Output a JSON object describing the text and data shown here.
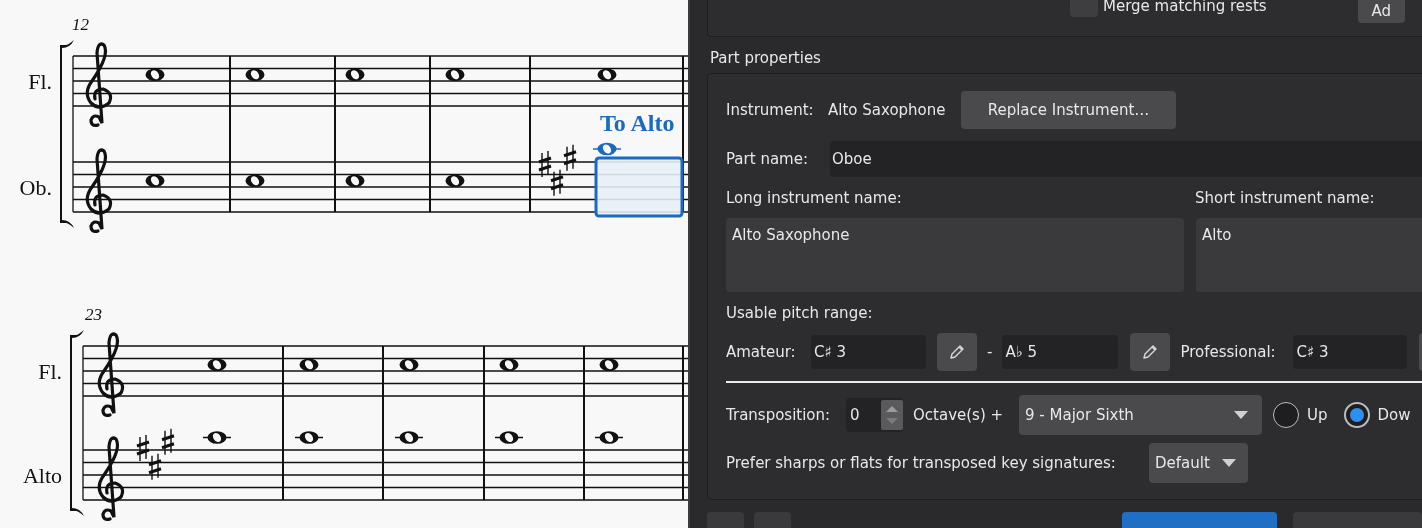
{
  "score": {
    "systems": [
      {
        "measure_number": "12",
        "staff_text": "To Alto",
        "staves": [
          {
            "label": "Fl."
          },
          {
            "label": "Ob."
          }
        ]
      },
      {
        "measure_number": "23",
        "staves": [
          {
            "label": "Fl."
          },
          {
            "label": "Alto"
          }
        ]
      }
    ]
  },
  "dialog": {
    "top_row": {
      "checkbox": {
        "label": "Merge matching rests",
        "checked": false
      },
      "button": "Ad"
    },
    "part_properties": {
      "title": "Part properties",
      "instrument_label": "Instrument:",
      "instrument": "Alto Saxophone",
      "replace_button": "Replace Instrument…",
      "part_name_label": "Part name:",
      "part_name": "Oboe",
      "long_name_label": "Long instrument name:",
      "long_name": "Alto Saxophone",
      "short_name_label": "Short instrument name:",
      "short_name": "Alto",
      "range_label": "Usable pitch range:",
      "amateur_label": "Amateur:",
      "amateur_low": "C♯ 3",
      "range_dash": "-",
      "amateur_high": "A♭ 5",
      "professional_label": "Professional:",
      "professional_low": "C♯ 3",
      "transposition_label": "Transposition:",
      "octaves": "0",
      "octaves_label": "Octave(s) +",
      "interval": "9 - Major Sixth",
      "directions": [
        {
          "label": "Up",
          "selected": false
        },
        {
          "label": "Dow",
          "selected": true
        }
      ],
      "key_pref_label": "Prefer sharps or flats for transposed key signatures:",
      "key_pref": "Default"
    }
  }
}
